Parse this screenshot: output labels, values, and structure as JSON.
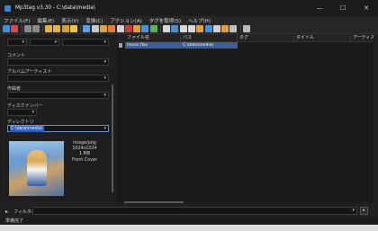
{
  "window": {
    "title": "Mp3tag v3.30 - C:\\data\\media\\"
  },
  "window_controls": {
    "minimize": "—",
    "maximize": "☐",
    "close": "✕"
  },
  "menu": [
    "ファイル(F)",
    "編集(E)",
    "表示(V)",
    "変換(C)",
    "アクション(A)",
    "タグを取得(S)",
    "ヘルプ(H)"
  ],
  "toolbar_icons": [
    "save-icon",
    "remove-tag-icon",
    "undo-icon",
    "redo-icon",
    "open-folder-icon",
    "add-folder-icon",
    "playlist-icon",
    "favorite-icon",
    "options-icon",
    "convert-icon",
    "action-icon",
    "web-source-icon",
    "search-icon"
  ],
  "left_panel": {
    "fields": [
      {
        "label": "コメント",
        "value": ""
      },
      {
        "label": "アルバムアーティスト",
        "value": ""
      },
      {
        "label": "作曲者",
        "value": ""
      },
      {
        "label": "ディスクナンバー",
        "value": ""
      },
      {
        "label": "ディレクトリ",
        "value": "C:\\data\\media\\"
      }
    ],
    "cover": {
      "format": "image/png",
      "dimensions": "1024x1024",
      "size": "1 MB",
      "type": "Front Cover"
    }
  },
  "file_list": {
    "columns": [
      "ファイル名",
      "パス",
      "タグ",
      "タイトル",
      "アーティスト"
    ],
    "rows": [
      {
        "filename": "music.flac",
        "path": "C:\\data\\media\\",
        "tag": "",
        "title": "",
        "artist": ""
      }
    ]
  },
  "filter": {
    "label": "フィルタ:",
    "value": "",
    "button": "▸"
  },
  "status": {
    "text": "準備完了"
  },
  "colors": {
    "background": "#202020",
    "selection": "#3a5f9c",
    "accent": "#2e5db8"
  }
}
